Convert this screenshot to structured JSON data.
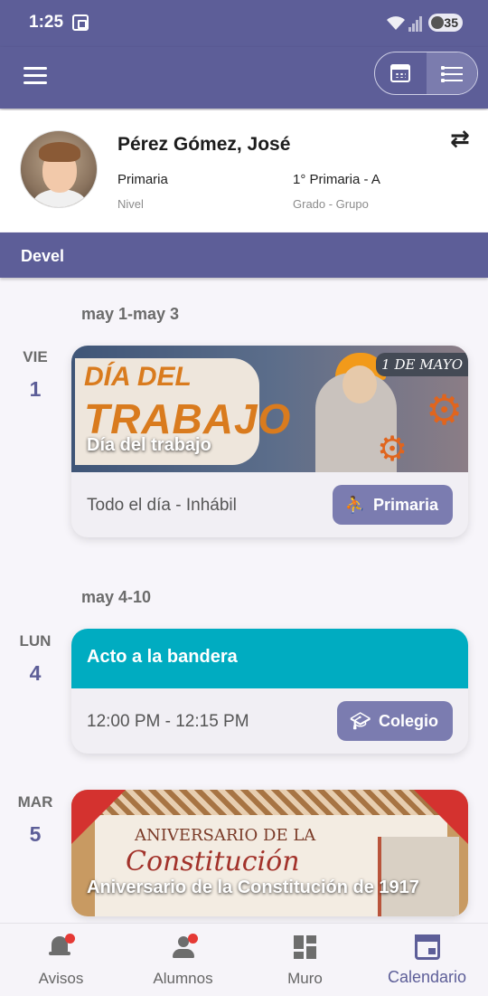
{
  "status": {
    "time": "1:25",
    "battery": "35"
  },
  "profile": {
    "name": "Pérez Gómez, José",
    "level_value": "Primaria",
    "level_label": "Nivel",
    "grade_value": "1° Primaria - A",
    "grade_label": "Grado - Grupo"
  },
  "group_bar": {
    "title": "Devel"
  },
  "weeks": [
    {
      "range": "may 1-may 3",
      "day": {
        "dow": "VIE",
        "num": "1"
      },
      "event": {
        "title": "Día del trabajo",
        "banner_lines": [
          "DÍA DEL",
          "TRABAJO",
          "1 DE MAYO"
        ],
        "when": "Todo el día - Inhábil",
        "chip": "Primaria"
      }
    },
    {
      "range": "may 4-10",
      "day": {
        "dow": "LUN",
        "num": "4"
      },
      "event": {
        "title": "Acto a la bandera",
        "when": "12:00 PM - 12:15 PM",
        "chip": "Colegio",
        "color": "#00acc1"
      }
    },
    {
      "day": {
        "dow": "MAR",
        "num": "5"
      },
      "event": {
        "title": "Aniversario de la Constitución de 1917",
        "banner_lines": [
          "ANIVERSARIO DE LA",
          "Constitución"
        ]
      }
    }
  ],
  "bottom_nav": [
    {
      "label": "Avisos",
      "icon": "bell-icon",
      "badge": true
    },
    {
      "label": "Alumnos",
      "icon": "people-icon",
      "badge": true
    },
    {
      "label": "Muro",
      "icon": "dashboard-icon",
      "badge": false
    },
    {
      "label": "Calendario",
      "icon": "calendar-icon",
      "badge": false,
      "active": true
    }
  ],
  "colors": {
    "primary": "#5d5e98",
    "chip": "#7b7cb0",
    "accent_teal": "#00acc1",
    "badge": "#e53935"
  }
}
